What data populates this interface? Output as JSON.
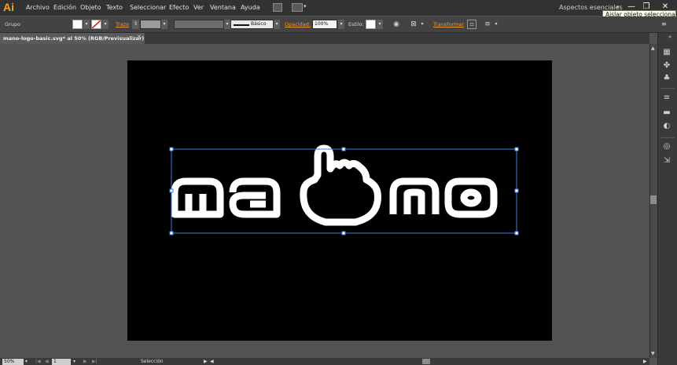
{
  "app": {
    "logo": "Ai"
  },
  "menu": [
    "Archivo",
    "Edición",
    "Objeto",
    "Texto",
    "Seleccionar",
    "Efecto",
    "Ver",
    "Ventana",
    "Ayuda"
  ],
  "workspace": {
    "label": "Aspectos esenciales",
    "arrow": "▾"
  },
  "window_buttons": {
    "minimize": "—",
    "restore": "❐",
    "close": "✕"
  },
  "tooltip": "Aislar objeto seleccionado",
  "control_bar": {
    "selection_type": "Grupo",
    "stroke_label": "Trazo",
    "stroke_value": "",
    "brush_label": "Básico",
    "opacity_label": "Opacidad:",
    "opacity_value": "100%",
    "style_label": "Estilo:",
    "transform_label": "Transformar",
    "dropdown_arrow": "▾",
    "fill_color": "#ffffff",
    "stroke_color": "#ffffff"
  },
  "tab": {
    "title": "mano-logo-basic.svg* al 50% (RGB/Previsualizar)",
    "close": "✕"
  },
  "artboard": {
    "background": "#000000",
    "logo_color": "#ffffff",
    "selection_color": "#3f7fe0"
  },
  "status_bar": {
    "zoom": "50%",
    "artboard_number": "1",
    "status_text": "Selección",
    "nav_first": "|◀",
    "nav_prev": "◀",
    "nav_next": "▶",
    "nav_last": "▶|",
    "play": "▶",
    "scroll_left": "◀",
    "scroll_right": "▶"
  },
  "scrollbar": {
    "up": "▲",
    "down": "▼",
    "left": "◀"
  },
  "panel_collapse": "«",
  "panel_menu": "≡"
}
